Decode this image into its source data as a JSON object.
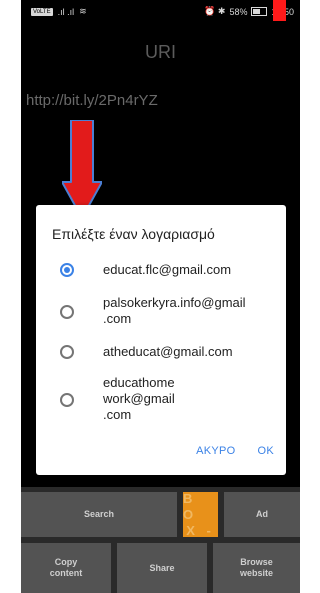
{
  "statusbar": {
    "volte": "VoLTE",
    "signal_text": ".ıl .ıl",
    "right_icons": "⏰ ✱",
    "battery": "58%",
    "time": "12:50"
  },
  "app": {
    "title": "URI",
    "link": "http://bit.ly/2Pn4rYZ"
  },
  "dialog": {
    "title": "Επιλέξτε έναν λογαριασμό",
    "options": [
      {
        "label": "educat.flc@gmail.com",
        "checked": true
      },
      {
        "label": "palsokerkyra.info@gmail .com",
        "line1": "palsokerkyra.info@gmail",
        "line2": ".com",
        "checked": false
      },
      {
        "label": "atheducat@gmail.com",
        "checked": false
      },
      {
        "label": "educathome work@gmail .com",
        "line1": "educathome",
        "line2": "work@gmail",
        "line3": ".com",
        "checked": false
      }
    ],
    "cancel": "ΑΚΥΡΟ",
    "ok": "OK"
  },
  "buttons": {
    "search": "Search",
    "box_top": "B O",
    "box_bottom": "X -",
    "ad": "Ad",
    "copy_line1": "Copy",
    "copy_line2": "content",
    "share": "Share",
    "browse_line1": "Browse",
    "browse_line2": "website"
  },
  "colors": {
    "accent": "#3b82e6",
    "arrow": "#e21b1b",
    "arrow_outline": "#4a7fd4",
    "box": "#e8911a"
  }
}
